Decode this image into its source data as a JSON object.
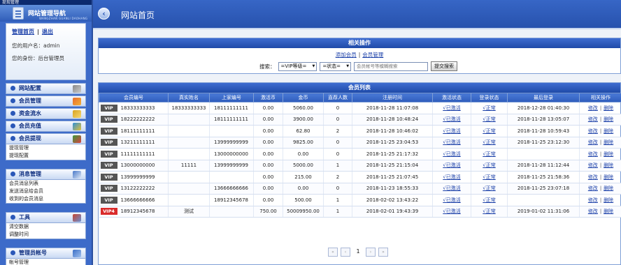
{
  "sidebar": {
    "top_text": "提现管理",
    "title": "网站管理导航",
    "subtitle": "WANGZHAN GUANLI DAOHANG",
    "links": {
      "home": "管理首页",
      "logout": "退出"
    },
    "user_label": "您的用户名：admin",
    "role_label": "您的身份：后台管理员",
    "menus": [
      {
        "label": "网站配置"
      },
      {
        "label": "会员管理"
      },
      {
        "label": "资金流水"
      },
      {
        "label": "会员充值"
      },
      {
        "label": "会员提现",
        "items": [
          "提现管理",
          "提现配置"
        ]
      },
      {
        "label": "消息管理",
        "items": [
          "会员消息列表",
          "发送消息给会员",
          "收到的会员消息"
        ]
      },
      {
        "label": "工具",
        "items": [
          "清空数据",
          "调整时间"
        ]
      },
      {
        "label": "管理员帐号",
        "items": [
          "帐号管理"
        ]
      }
    ]
  },
  "header": {
    "breadcrumb": "网站首页"
  },
  "ops": {
    "title": "相关操作",
    "add_member": "添加会员",
    "member_mgmt": "会员管理",
    "search_label": "搜索：",
    "vip_select": "=VIP等级=",
    "status_select": "=状态=",
    "search_placeholder": "会员帐号等模糊搜索",
    "search_button": "提交搜索"
  },
  "list": {
    "title": "会员列表",
    "columns": [
      "会员编号",
      "真实姓名",
      "上家编号",
      "激活币",
      "金币",
      "直荐人数",
      "注册时间",
      "激活状态",
      "登录状态",
      "最后登录",
      "相关操作"
    ],
    "rows": [
      {
        "vip": "VIP",
        "id": "18333333333",
        "name": "18333333333",
        "parent": "18111111111",
        "act": "0.00",
        "gold": "5060.00",
        "refs": "0",
        "reg": "2018-11-28 11:07:08",
        "active": "√已激活",
        "login": "√正常",
        "last": "2018-12-28 01:40:30"
      },
      {
        "vip": "VIP",
        "id": "18222222222",
        "name": "",
        "parent": "18111111111",
        "act": "0.00",
        "gold": "3900.00",
        "refs": "0",
        "reg": "2018-11-28 10:48:24",
        "active": "√已激活",
        "login": "√正常",
        "last": "2018-11-28 13:05:07"
      },
      {
        "vip": "VIP",
        "id": "18111111111",
        "name": "",
        "parent": "",
        "act": "0.00",
        "gold": "62.80",
        "refs": "2",
        "reg": "2018-11-28 10:46:02",
        "active": "√已激活",
        "login": "√正常",
        "last": "2018-11-28 10:59:43"
      },
      {
        "vip": "VIP",
        "id": "13211111111",
        "name": "",
        "parent": "13999999999",
        "act": "0.00",
        "gold": "9825.00",
        "refs": "0",
        "reg": "2018-11-25 23:04:53",
        "active": "√已激活",
        "login": "√正常",
        "last": "2018-11-25 23:12:30"
      },
      {
        "vip": "VIP",
        "id": "11111111111",
        "name": "",
        "parent": "13000000000",
        "act": "0.00",
        "gold": "0.00",
        "refs": "0",
        "reg": "2018-11-25 21:17:32",
        "active": "√已激活",
        "login": "√正常",
        "last": ""
      },
      {
        "vip": "VIP",
        "id": "13000000000",
        "name": "11111",
        "parent": "13999999999",
        "act": "0.00",
        "gold": "5000.00",
        "refs": "1",
        "reg": "2018-11-25 21:15:04",
        "active": "√已激活",
        "login": "√正常",
        "last": "2018-11-28 11:12:44"
      },
      {
        "vip": "VIP",
        "id": "13999999999",
        "name": "",
        "parent": "",
        "act": "0.00",
        "gold": "215.00",
        "refs": "2",
        "reg": "2018-11-25 21:07:45",
        "active": "√已激活",
        "login": "√正常",
        "last": "2018-11-25 21:58:36"
      },
      {
        "vip": "VIP",
        "id": "13122222222",
        "name": "",
        "parent": "13666666666",
        "act": "0.00",
        "gold": "0.00",
        "refs": "0",
        "reg": "2018-11-23 18:55:33",
        "active": "√已激活",
        "login": "√正常",
        "last": "2018-11-25 23:07:18"
      },
      {
        "vip": "VIP",
        "id": "13666666666",
        "name": "",
        "parent": "18912345678",
        "act": "0.00",
        "gold": "500.00",
        "refs": "1",
        "reg": "2018-02-02 13:43:22",
        "active": "√已激活",
        "login": "√正常",
        "last": ""
      },
      {
        "vip": "VIP4",
        "id": "18912345678",
        "name": "测试",
        "parent": "",
        "act": "750.00",
        "gold": "50009950.00",
        "refs": "1",
        "reg": "2018-02-01 19:43:39",
        "active": "√已激活",
        "login": "√正常",
        "last": "2019-01-02 11:31:06"
      }
    ],
    "edit_label": "修改",
    "delete_label": "删除"
  },
  "pager": {
    "first": "«",
    "prev": "‹",
    "current": "1",
    "next": "›",
    "last": "»"
  },
  "colors": {
    "header_blue": "#2752ad",
    "badge_vip": "#555555",
    "badge_vip4": "#d92b2b",
    "link": "#1a3fa8"
  },
  "icons": [
    "wrench-icon",
    "users-icon",
    "money-icon",
    "recharge-icon",
    "withdraw-icon",
    "message-icon",
    "tools-icon",
    "admin-icon"
  ]
}
